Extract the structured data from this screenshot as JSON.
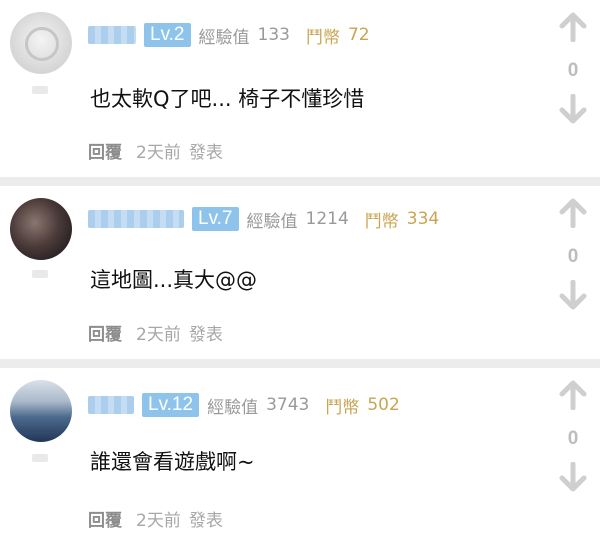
{
  "comments": [
    {
      "level": "Lv.2",
      "exp_label": "經驗值",
      "exp_value": "133",
      "coin_label": "鬥幣",
      "coin_value": "72",
      "text": "也太軟Q了吧... 椅子不懂珍惜",
      "reply": "回覆",
      "time": "2天前",
      "posted": "發表",
      "votes": "0"
    },
    {
      "level": "Lv.7",
      "exp_label": "經驗值",
      "exp_value": "1214",
      "coin_label": "鬥幣",
      "coin_value": "334",
      "text": "這地圖...真大@@",
      "reply": "回覆",
      "time": "2天前",
      "posted": "發表",
      "votes": "0"
    },
    {
      "level": "Lv.12",
      "exp_label": "經驗值",
      "exp_value": "3743",
      "coin_label": "鬥幣",
      "coin_value": "502",
      "text": "誰還會看遊戲啊~",
      "reply": "回覆",
      "time": "2天前",
      "posted": "發表",
      "votes": "0"
    }
  ],
  "colors": {
    "level_badge": "#8ec4ec",
    "coin_text": "#c8a552",
    "meta_text": "#a7a7a7",
    "arrow": "#d0d0d0"
  },
  "icons": {
    "upvote": "arrow-up-icon",
    "downvote": "arrow-down-icon"
  }
}
